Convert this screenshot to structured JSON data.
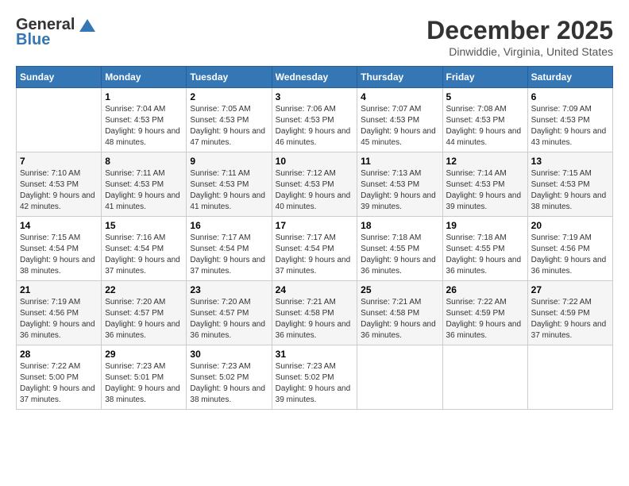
{
  "header": {
    "logo_general": "General",
    "logo_blue": "Blue",
    "month": "December 2025",
    "location": "Dinwiddie, Virginia, United States"
  },
  "weekdays": [
    "Sunday",
    "Monday",
    "Tuesday",
    "Wednesday",
    "Thursday",
    "Friday",
    "Saturday"
  ],
  "weeks": [
    [
      {
        "day": "",
        "sunrise": "",
        "sunset": "",
        "daylight": ""
      },
      {
        "day": "1",
        "sunrise": "7:04 AM",
        "sunset": "4:53 PM",
        "daylight": "9 hours and 48 minutes."
      },
      {
        "day": "2",
        "sunrise": "7:05 AM",
        "sunset": "4:53 PM",
        "daylight": "9 hours and 47 minutes."
      },
      {
        "day": "3",
        "sunrise": "7:06 AM",
        "sunset": "4:53 PM",
        "daylight": "9 hours and 46 minutes."
      },
      {
        "day": "4",
        "sunrise": "7:07 AM",
        "sunset": "4:53 PM",
        "daylight": "9 hours and 45 minutes."
      },
      {
        "day": "5",
        "sunrise": "7:08 AM",
        "sunset": "4:53 PM",
        "daylight": "9 hours and 44 minutes."
      },
      {
        "day": "6",
        "sunrise": "7:09 AM",
        "sunset": "4:53 PM",
        "daylight": "9 hours and 43 minutes."
      }
    ],
    [
      {
        "day": "7",
        "sunrise": "7:10 AM",
        "sunset": "4:53 PM",
        "daylight": "9 hours and 42 minutes."
      },
      {
        "day": "8",
        "sunrise": "7:11 AM",
        "sunset": "4:53 PM",
        "daylight": "9 hours and 41 minutes."
      },
      {
        "day": "9",
        "sunrise": "7:11 AM",
        "sunset": "4:53 PM",
        "daylight": "9 hours and 41 minutes."
      },
      {
        "day": "10",
        "sunrise": "7:12 AM",
        "sunset": "4:53 PM",
        "daylight": "9 hours and 40 minutes."
      },
      {
        "day": "11",
        "sunrise": "7:13 AM",
        "sunset": "4:53 PM",
        "daylight": "9 hours and 39 minutes."
      },
      {
        "day": "12",
        "sunrise": "7:14 AM",
        "sunset": "4:53 PM",
        "daylight": "9 hours and 39 minutes."
      },
      {
        "day": "13",
        "sunrise": "7:15 AM",
        "sunset": "4:53 PM",
        "daylight": "9 hours and 38 minutes."
      }
    ],
    [
      {
        "day": "14",
        "sunrise": "7:15 AM",
        "sunset": "4:54 PM",
        "daylight": "9 hours and 38 minutes."
      },
      {
        "day": "15",
        "sunrise": "7:16 AM",
        "sunset": "4:54 PM",
        "daylight": "9 hours and 37 minutes."
      },
      {
        "day": "16",
        "sunrise": "7:17 AM",
        "sunset": "4:54 PM",
        "daylight": "9 hours and 37 minutes."
      },
      {
        "day": "17",
        "sunrise": "7:17 AM",
        "sunset": "4:54 PM",
        "daylight": "9 hours and 37 minutes."
      },
      {
        "day": "18",
        "sunrise": "7:18 AM",
        "sunset": "4:55 PM",
        "daylight": "9 hours and 36 minutes."
      },
      {
        "day": "19",
        "sunrise": "7:18 AM",
        "sunset": "4:55 PM",
        "daylight": "9 hours and 36 minutes."
      },
      {
        "day": "20",
        "sunrise": "7:19 AM",
        "sunset": "4:56 PM",
        "daylight": "9 hours and 36 minutes."
      }
    ],
    [
      {
        "day": "21",
        "sunrise": "7:19 AM",
        "sunset": "4:56 PM",
        "daylight": "9 hours and 36 minutes."
      },
      {
        "day": "22",
        "sunrise": "7:20 AM",
        "sunset": "4:57 PM",
        "daylight": "9 hours and 36 minutes."
      },
      {
        "day": "23",
        "sunrise": "7:20 AM",
        "sunset": "4:57 PM",
        "daylight": "9 hours and 36 minutes."
      },
      {
        "day": "24",
        "sunrise": "7:21 AM",
        "sunset": "4:58 PM",
        "daylight": "9 hours and 36 minutes."
      },
      {
        "day": "25",
        "sunrise": "7:21 AM",
        "sunset": "4:58 PM",
        "daylight": "9 hours and 36 minutes."
      },
      {
        "day": "26",
        "sunrise": "7:22 AM",
        "sunset": "4:59 PM",
        "daylight": "9 hours and 36 minutes."
      },
      {
        "day": "27",
        "sunrise": "7:22 AM",
        "sunset": "4:59 PM",
        "daylight": "9 hours and 37 minutes."
      }
    ],
    [
      {
        "day": "28",
        "sunrise": "7:22 AM",
        "sunset": "5:00 PM",
        "daylight": "9 hours and 37 minutes."
      },
      {
        "day": "29",
        "sunrise": "7:23 AM",
        "sunset": "5:01 PM",
        "daylight": "9 hours and 38 minutes."
      },
      {
        "day": "30",
        "sunrise": "7:23 AM",
        "sunset": "5:02 PM",
        "daylight": "9 hours and 38 minutes."
      },
      {
        "day": "31",
        "sunrise": "7:23 AM",
        "sunset": "5:02 PM",
        "daylight": "9 hours and 39 minutes."
      },
      {
        "day": "",
        "sunrise": "",
        "sunset": "",
        "daylight": ""
      },
      {
        "day": "",
        "sunrise": "",
        "sunset": "",
        "daylight": ""
      },
      {
        "day": "",
        "sunrise": "",
        "sunset": "",
        "daylight": ""
      }
    ]
  ],
  "labels": {
    "sunrise": "Sunrise:",
    "sunset": "Sunset:",
    "daylight": "Daylight:"
  }
}
